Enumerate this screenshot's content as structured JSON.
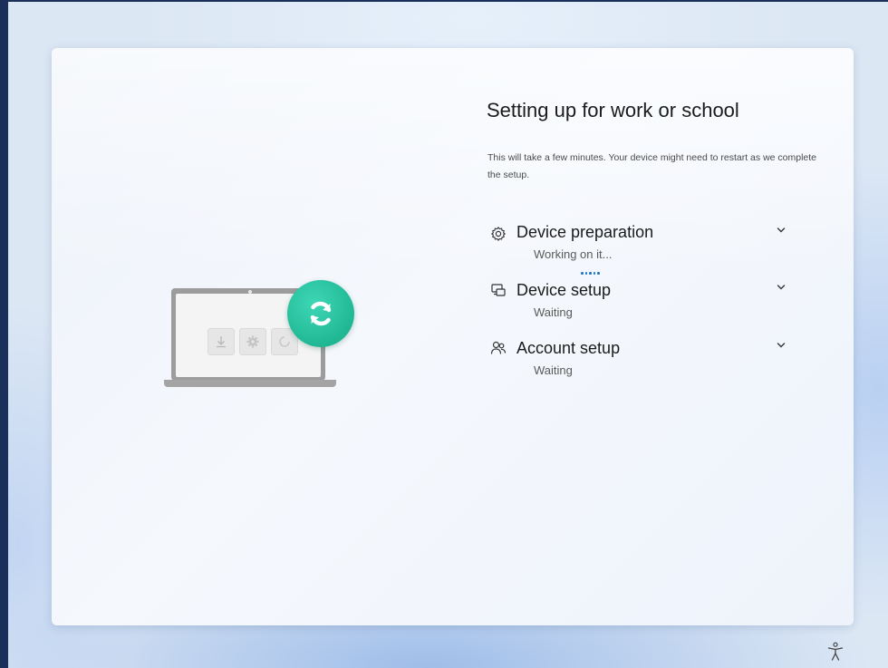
{
  "setup": {
    "title": "Setting up for work or school",
    "description": "This will take a few minutes. Your device might need to restart as we complete the setup.",
    "steps": [
      {
        "name": "Device preparation",
        "status": "Working on it...",
        "icon": "gear-icon"
      },
      {
        "name": "Device setup",
        "status": "Waiting",
        "icon": "devices-icon"
      },
      {
        "name": "Account setup",
        "status": "Waiting",
        "icon": "people-icon"
      }
    ]
  },
  "illustration": {
    "badge_color": "#20b894",
    "icons": [
      "download-icon",
      "settings-icon",
      "loading-icon",
      "sync-icon"
    ]
  },
  "footer": {
    "accessibility_icon": "accessibility-icon"
  }
}
